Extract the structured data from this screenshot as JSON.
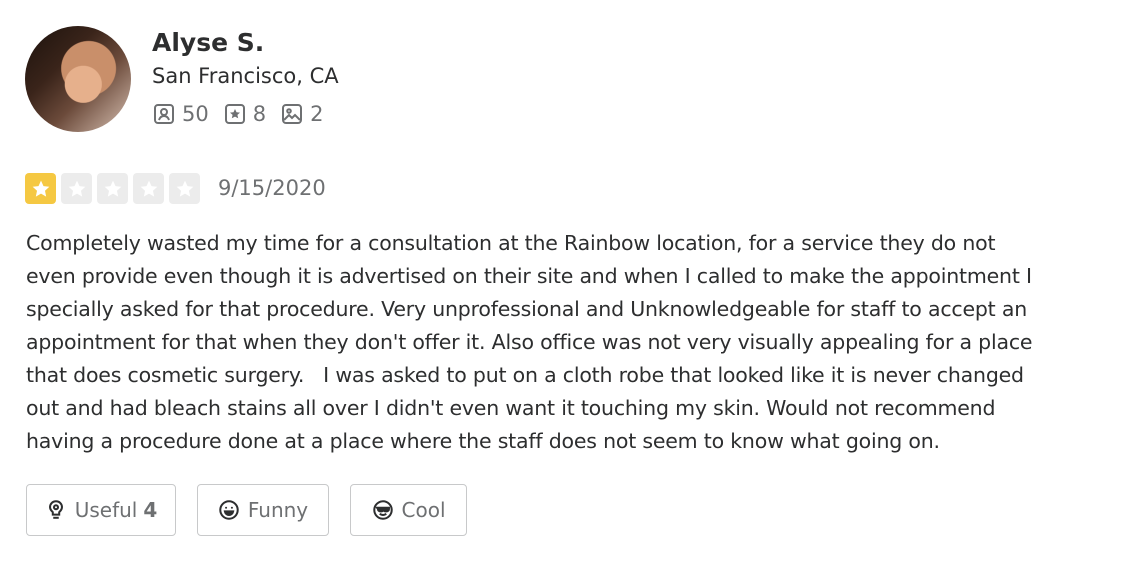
{
  "reviewer": {
    "name": "Alyse S.",
    "location": "San Francisco, CA",
    "stats": [
      {
        "icon": "friends-icon",
        "value": "50"
      },
      {
        "icon": "star-review-icon",
        "value": "8"
      },
      {
        "icon": "photo-icon",
        "value": "2"
      }
    ]
  },
  "rating": {
    "value": 1,
    "max": 5,
    "filled_color": "#f5c842",
    "empty_color": "#ececec"
  },
  "review": {
    "date": "9/15/2020",
    "text": "Completely wasted my time for a consultation at the Rainbow location, for a service they do not\neven provide even though it is advertised on their site and when I called to make the appointment I\nspecially asked for that procedure. Very unprofessional and Unknowledgeable for staff to accept an\nappointment for that when they don't offer it. Also office was not very visually appealing for a place\nthat does cosmetic surgery.   I was asked to put on a cloth robe that looked like it is never changed\nout and had bleach stains all over I didn't even want it touching my skin. Would not recommend\nhaving a procedure done at a place where the staff does not seem to know what going on."
  },
  "reactions": {
    "useful": {
      "label": "Useful",
      "count": "4",
      "icon": "lightbulb-icon"
    },
    "funny": {
      "label": "Funny",
      "icon": "smile-icon"
    },
    "cool": {
      "label": "Cool",
      "icon": "sunglasses-icon"
    }
  }
}
